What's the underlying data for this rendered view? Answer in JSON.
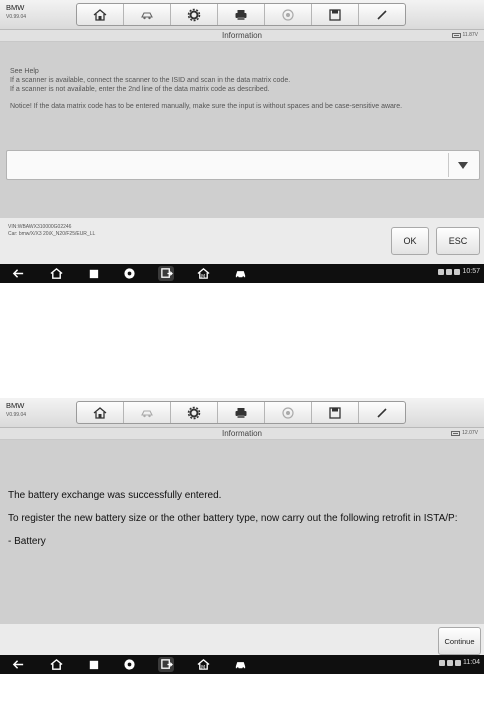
{
  "app": {
    "title": "BMW",
    "version": "V0.99.04"
  },
  "toolbar_icons": [
    "home-icon",
    "vehicle-swap-icon",
    "settings-gear-icon",
    "print-icon",
    "help-icon",
    "save-icon",
    "edit-pen-icon"
  ],
  "screen1": {
    "info_title": "Information",
    "voltage": "11.87V",
    "help_lines": [
      "See Help",
      "If a scanner is available, connect the scanner to the ISID and scan in the data matrix code.",
      "If a scanner is not available, enter the 2nd line of the data matrix code as described.",
      "",
      "Notice! If the data matrix code has to be entered manually, make sure the input is without spaces and be case-sensitive aware."
    ],
    "dropdown_value": "",
    "vin": "VIN:WBAWX310000G02246",
    "car": "Car: bmw/X/X3 20iX_N20/F25/EUR_LL",
    "ok_label": "OK",
    "esc_label": "ESC",
    "time": "10:57"
  },
  "screen2": {
    "info_title": "Information",
    "voltage": "12.07V",
    "message": [
      "The battery exchange was successfully entered.",
      "To register the new battery size or the other battery type, now carry out the following retrofit in ISTA/P:",
      "- Battery"
    ],
    "continue_label": "Continue",
    "time": "11:04"
  },
  "nav_icons": [
    "back-icon",
    "home-icon",
    "recent-apps-icon",
    "browser-icon",
    "screen-switch-icon",
    "autel-home-icon",
    "vehicle-icon"
  ]
}
